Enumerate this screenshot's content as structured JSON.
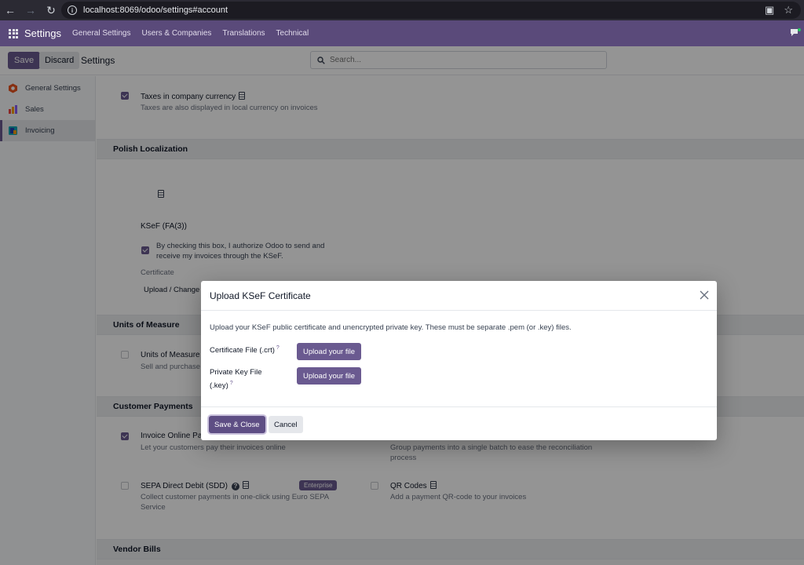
{
  "browser": {
    "url": "localhost:8069/odoo/settings#account"
  },
  "navbar": {
    "brand": "Settings",
    "menus": [
      "General Settings",
      "Users & Companies",
      "Translations",
      "Technical"
    ]
  },
  "control_panel": {
    "save_label": "Save",
    "discard_label": "Discard",
    "title": "Settings",
    "search_placeholder": "Search..."
  },
  "sidebar": {
    "items": [
      {
        "label": "General Settings",
        "color": "#e8531f"
      },
      {
        "label": "Sales",
        "color": "#f59e0b"
      },
      {
        "label": "Invoicing",
        "color": "#0ea5b7"
      }
    ],
    "active_index": 2
  },
  "main": {
    "taxes_currency": {
      "title": "Taxes in company currency",
      "desc": "Taxes are also displayed in local currency on invoices"
    },
    "polish": {
      "section": "Polish Localization",
      "ksef_title": "KSeF (FA(3))",
      "ksef_checkbox_text": "By checking this box, I authorize Odoo to send and receive my invoices through the KSeF.",
      "certificate_label": "Certificate",
      "upload_change": "Upload / Change"
    },
    "uom": {
      "section": "Units of Measure",
      "title": "Units of Measure",
      "desc": "Sell and purchase"
    },
    "customer_payments": {
      "section": "Customer Payments",
      "invoice_online_title": "Invoice Online Pa",
      "invoice_online_desc": "Let your customers pay their invoices online",
      "batch_desc": "Group payments into a single batch to ease the reconciliation process",
      "sepa_title": "SEPA Direct Debit (SDD)",
      "sepa_badge": "Enterprise",
      "sepa_desc": "Collect customer payments in one-click using Euro SEPA Service",
      "qr_title": "QR Codes",
      "qr_desc": "Add a payment QR-code to your invoices"
    },
    "vendor_bills": {
      "section": "Vendor Bills"
    }
  },
  "modal": {
    "title": "Upload KSeF Certificate",
    "intro": "Upload your KSeF public certificate and unencrypted private key. These must be separate .pem (or .key) files.",
    "cert_label": "Certificate File (.crt)",
    "key_label_line1": "Private Key File",
    "key_label_line2": "(.key)",
    "help_mark": "?",
    "upload_label": "Upload your file",
    "save_close": "Save & Close",
    "cancel": "Cancel"
  }
}
